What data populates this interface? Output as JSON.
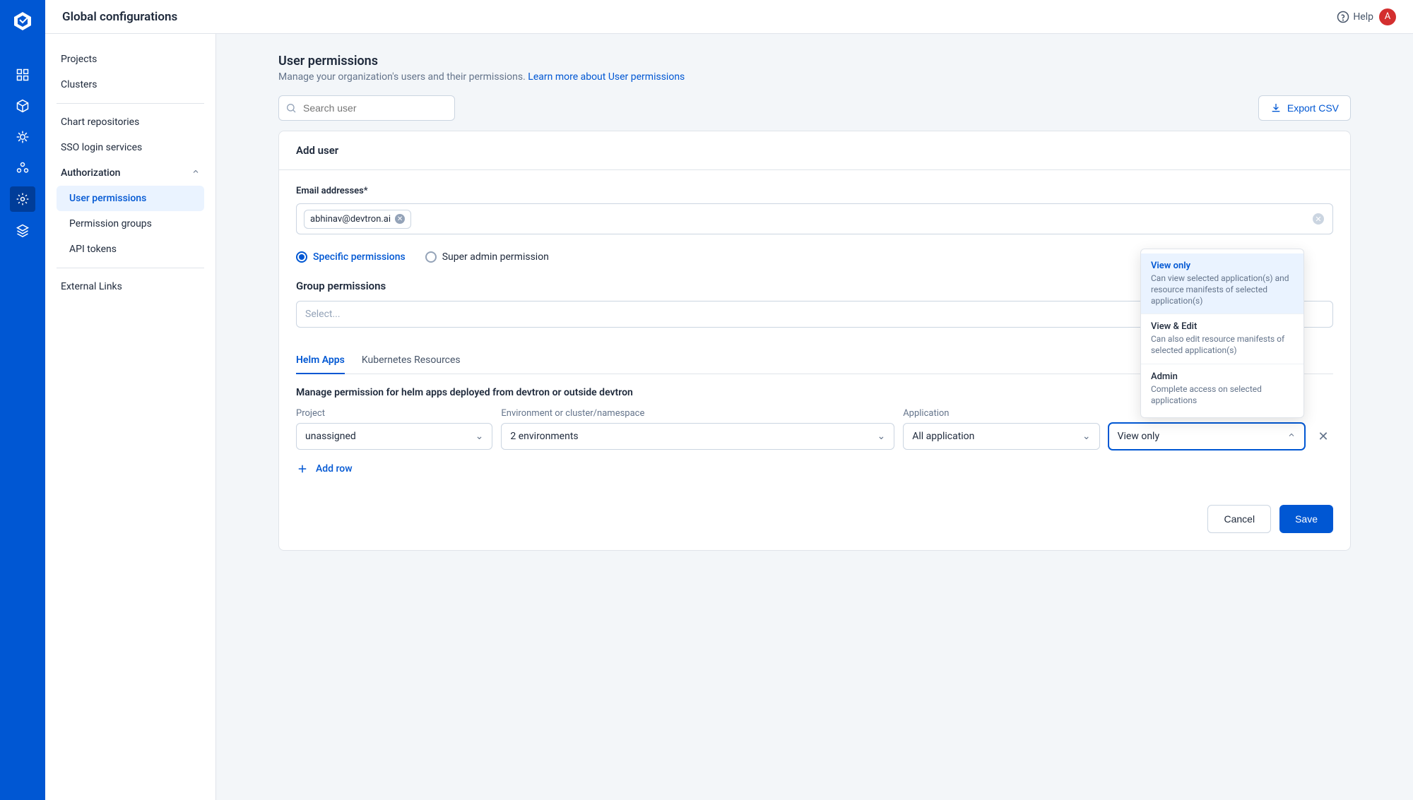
{
  "topbar": {
    "title": "Global configurations",
    "help": "Help",
    "avatar": "A"
  },
  "sidebar": {
    "items": {
      "projects": "Projects",
      "clusters": "Clusters",
      "chart_repos": "Chart repositories",
      "sso": "SSO login services",
      "authorization": "Authorization",
      "user_permissions": "User permissions",
      "permission_groups": "Permission groups",
      "api_tokens": "API tokens",
      "external_links": "External Links"
    }
  },
  "page": {
    "title": "User permissions",
    "subtitle": "Manage your organization's users and their permissions.",
    "learn_more": "Learn more about User permissions",
    "search_placeholder": "Search user",
    "export_csv": "Export CSV"
  },
  "form": {
    "header": "Add user",
    "email_label": "Email addresses*",
    "email_chip": "abhinav@devtron.ai",
    "perm_radio": {
      "specific": "Specific permissions",
      "super": "Super admin permission"
    },
    "group_perm_title": "Group permissions",
    "group_select_placeholder": "Select...",
    "tabs": {
      "helm": "Helm Apps",
      "k8s": "Kubernetes Resources"
    },
    "manage_desc": "Manage permission for helm apps deployed from devtron or outside devtron",
    "cols": {
      "project": "Project",
      "env": "Environment or cluster/namespace",
      "app": "Application",
      "role": ""
    },
    "values": {
      "project": "unassigned",
      "env": "2 environments",
      "app": "All application",
      "role": "View only"
    },
    "add_row": "Add row",
    "cancel": "Cancel",
    "save": "Save"
  },
  "role_dropdown": [
    {
      "title": "View only",
      "desc": "Can view selected application(s) and resource manifests of selected application(s)",
      "selected": true
    },
    {
      "title": "View & Edit",
      "desc": "Can also edit resource manifests of selected application(s)",
      "selected": false
    },
    {
      "title": "Admin",
      "desc": "Complete access on selected applications",
      "selected": false
    }
  ]
}
